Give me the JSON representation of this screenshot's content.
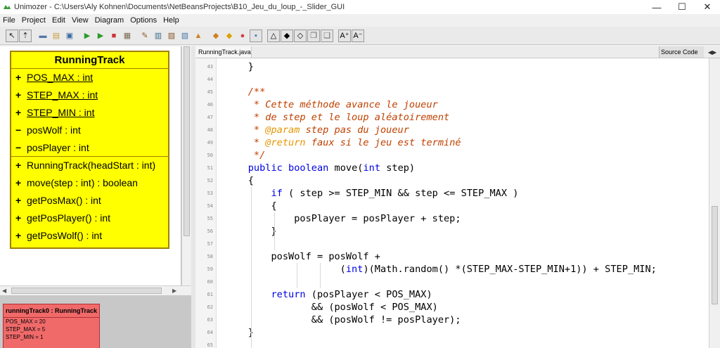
{
  "window": {
    "title": "Unimozer - C:\\Users\\Aly Kohnen\\Documents\\NetBeansProjects\\B10_Jeu_du_loup_-_Slider_GUI",
    "controls": [
      "—",
      "☐",
      "✕"
    ]
  },
  "menu": [
    "File",
    "Project",
    "Edit",
    "View",
    "Diagram",
    "Options",
    "Help"
  ],
  "toolbar": {
    "buttons": [
      {
        "icon": "select-arrow-icon",
        "glyph": "↖"
      },
      {
        "icon": "add-class-icon",
        "glyph": "⇡"
      },
      {
        "icon": "new-project-icon",
        "glyph": "▬"
      },
      {
        "icon": "open-folder-icon",
        "glyph": "▤"
      },
      {
        "icon": "save-icon",
        "glyph": "▣"
      },
      {
        "icon": "run-icon",
        "glyph": "▶"
      },
      {
        "icon": "run-step-icon",
        "glyph": "▶"
      },
      {
        "icon": "stop-icon",
        "glyph": "■"
      },
      {
        "icon": "make-icon",
        "glyph": "▦"
      },
      {
        "icon": "tool-icon",
        "glyph": "✎"
      },
      {
        "icon": "package-icon",
        "glyph": "▥"
      },
      {
        "icon": "jar-icon",
        "glyph": "▨"
      },
      {
        "icon": "javadoc-icon",
        "glyph": "▧"
      },
      {
        "icon": "lock-icon",
        "glyph": "▲"
      },
      {
        "icon": "structorizer-icon",
        "glyph": "◆"
      },
      {
        "icon": "diamond-icon",
        "glyph": "◆"
      },
      {
        "icon": "circle-icon",
        "glyph": "●"
      },
      {
        "icon": "square-icon",
        "glyph": "▪"
      },
      {
        "icon": "triangle-outline-icon",
        "glyph": "△"
      },
      {
        "icon": "diamond-filled-icon",
        "glyph": "◆"
      },
      {
        "icon": "diamond-outline-icon",
        "glyph": "◇"
      },
      {
        "icon": "copy-icon",
        "glyph": "❐"
      },
      {
        "icon": "paste-icon",
        "glyph": "❏"
      },
      {
        "icon": "font-increase-icon",
        "glyph": "A⁺"
      },
      {
        "icon": "font-decrease-icon",
        "glyph": "A⁻"
      }
    ]
  },
  "uml": {
    "class_name": "RunningTrack",
    "attributes": [
      {
        "vis": "+",
        "text": "POS_MAX : int",
        "static": true
      },
      {
        "vis": "+",
        "text": "STEP_MAX : int",
        "static": true
      },
      {
        "vis": "+",
        "text": "STEP_MIN : int",
        "static": true
      },
      {
        "vis": "−",
        "text": "posWolf : int",
        "static": false
      },
      {
        "vis": "−",
        "text": "posPlayer : int",
        "static": false
      }
    ],
    "methods": [
      {
        "vis": "+",
        "text": "RunningTrack(headStart : int)"
      },
      {
        "vis": "+",
        "text": "move(step : int) : boolean"
      },
      {
        "vis": "+",
        "text": "getPosMax() : int"
      },
      {
        "vis": "+",
        "text": "getPosPlayer() : int"
      },
      {
        "vis": "+",
        "text": "getPosWolf() : int"
      }
    ]
  },
  "object": {
    "title": "runningTrack0 : RunningTrack",
    "fields": [
      "POS_MAX = 20",
      "STEP_MAX = 5",
      "STEP_MIN = 1"
    ]
  },
  "editor": {
    "file_tab": "RunningTrack.java",
    "view_mode": "Source Code",
    "line_numbers": [
      "43",
      "44",
      "45",
      "46",
      "47",
      "48",
      "49",
      "50",
      "51",
      "52",
      "53",
      "54",
      "55",
      "56",
      "57",
      "58",
      "59",
      "60",
      "61",
      "62",
      "63",
      "64",
      "65"
    ],
    "lines": [
      "    }",
      "",
      "    /**",
      "     * Cette méthode avance le joueur",
      "     * de step et le loup aléatoirement",
      "     * @param step pas du joueur",
      "     * @return faux si le jeu est terminé",
      "     */",
      "    public boolean move(int step)",
      "    {",
      "        if ( step >= STEP_MIN && step <= STEP_MAX )",
      "        {",
      "            posPlayer = posPlayer + step;",
      "        }",
      "",
      "        posWolf = posWolf +",
      "                    (int)(Math.random() *(STEP_MAX-STEP_MIN+1)) + STEP_MIN;",
      "",
      "        return (posPlayer < POS_MAX)",
      "               && (posWolf < POS_MAX)",
      "               && (posWolf != posPlayer);",
      "    }",
      ""
    ]
  }
}
